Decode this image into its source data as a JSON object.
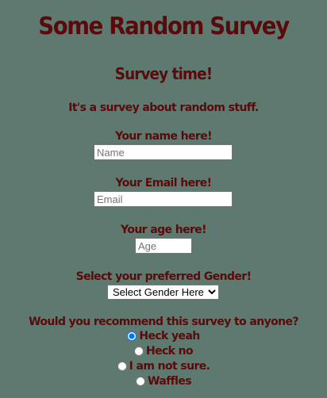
{
  "page": {
    "title": "Some Random Survey",
    "subtitle": "Survey time!",
    "description": "It's a survey about random stuff."
  },
  "form": {
    "name_label": "Your name here!",
    "name_placeholder": "Name",
    "email_label": "Your Email here!",
    "email_placeholder": "Email",
    "age_label": "Your age here!",
    "age_placeholder": "Age",
    "gender_label": "Select your preferred Gender!",
    "gender_selected": "Select Gender Here",
    "recommend_label": "Would you recommend this survey to anyone?",
    "recommend_options": [
      {
        "label": "Heck yeah",
        "checked": true
      },
      {
        "label": "Heck no",
        "checked": false
      },
      {
        "label": "I am not sure.",
        "checked": false
      },
      {
        "label": "Waffles",
        "checked": false
      }
    ]
  },
  "colors": {
    "background": "#5e7a70",
    "text": "#5a0a0a"
  }
}
